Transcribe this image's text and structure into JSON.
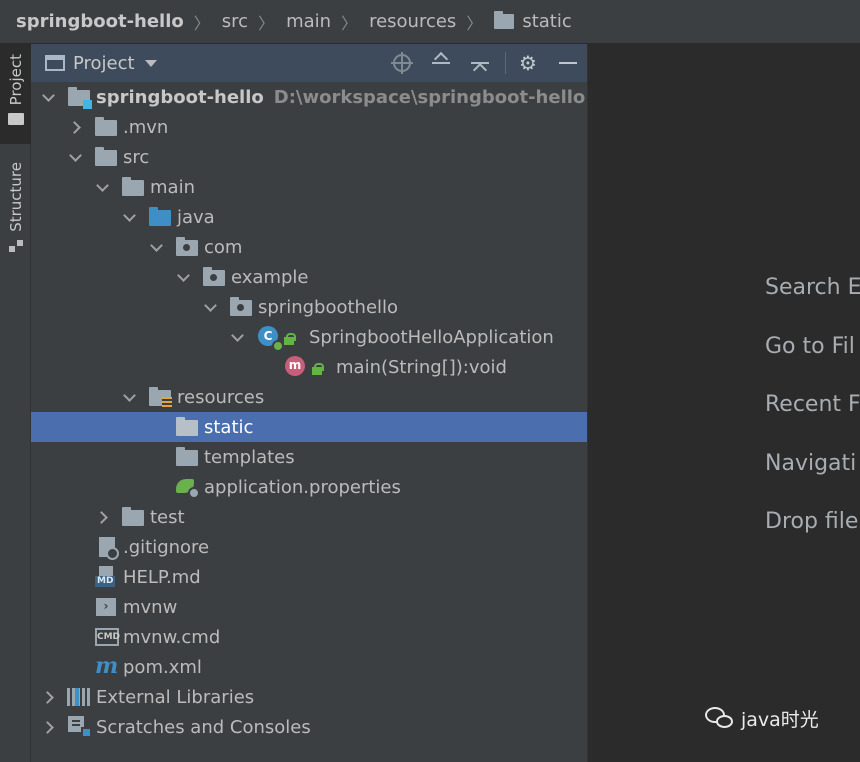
{
  "breadcrumb": {
    "items": [
      "springboot-hello",
      "src",
      "main",
      "resources",
      "static"
    ]
  },
  "tool_stripe": {
    "project_tab": "Project",
    "structure_tab": "Structure"
  },
  "project_panel": {
    "title": "Project",
    "tree": {
      "root_label": "springboot-hello",
      "root_path": "D:\\workspace\\springboot-hello",
      "mvn": ".mvn",
      "src": "src",
      "main": "main",
      "java": "java",
      "com": "com",
      "example": "example",
      "pkg": "springboothello",
      "app_class": "SpringbootHelloApplication",
      "main_method": "main(String[]):void",
      "resources": "resources",
      "static": "static",
      "templates": "templates",
      "app_props": "application.properties",
      "test": "test",
      "gitignore": ".gitignore",
      "help": "HELP.md",
      "mvnw": "mvnw",
      "mvnw_cmd": "mvnw.cmd",
      "pom": "pom.xml",
      "ext_libs": "External Libraries",
      "scratches": "Scratches and Consoles"
    },
    "selected": "static"
  },
  "editor": {
    "hints": [
      "Search E",
      "Go to Fil",
      "Recent F",
      "Navigati",
      "Drop file"
    ]
  },
  "watermark": {
    "text": "java时光"
  }
}
